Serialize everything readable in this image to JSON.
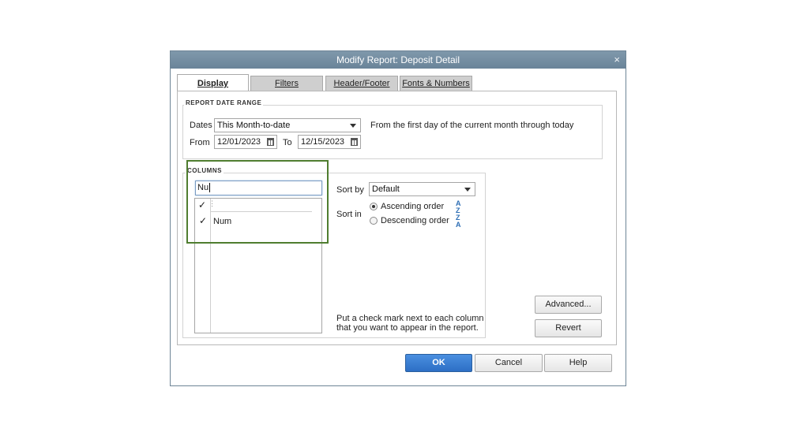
{
  "window": {
    "title": "Modify Report: Deposit Detail",
    "close_glyph": "×"
  },
  "tabs": [
    {
      "label": "Display",
      "active": true
    },
    {
      "label": "Filters",
      "active": false
    },
    {
      "label": "Header/Footer",
      "active": false
    },
    {
      "label": "Fonts & Numbers",
      "active": false
    }
  ],
  "date_range": {
    "section_title": "REPORT DATE RANGE",
    "dates_label": "Dates",
    "dates_value": "This Month-to-date",
    "description": "From the first day of the current month through today",
    "from_label": "From",
    "from_value": "12/01/2023",
    "to_label": "To",
    "to_value": "12/15/2023"
  },
  "columns": {
    "section_title": "COLUMNS",
    "search_value": "Nu",
    "header_check": "✓",
    "items": [
      {
        "check": "✓",
        "name": "Num"
      }
    ]
  },
  "sorting": {
    "sort_by_label": "Sort by",
    "sort_by_value": "Default",
    "sort_in_label": "Sort in",
    "ascending_label": "Ascending order",
    "descending_label": "Descending order",
    "selected": "ascending",
    "ascending_icon": "sort-ascending-icon",
    "descending_icon": "sort-descending-icon"
  },
  "hint_line1": "Put a check mark next to each column",
  "hint_line2": "that you want to appear in the report.",
  "buttons": {
    "advanced": "Advanced...",
    "revert": "Revert",
    "ok": "OK",
    "cancel": "Cancel",
    "help": "Help"
  },
  "colors": {
    "titlebar": "#6a8499",
    "highlight_border": "#4f7d2f",
    "ok_button": "#2d6fc5"
  }
}
